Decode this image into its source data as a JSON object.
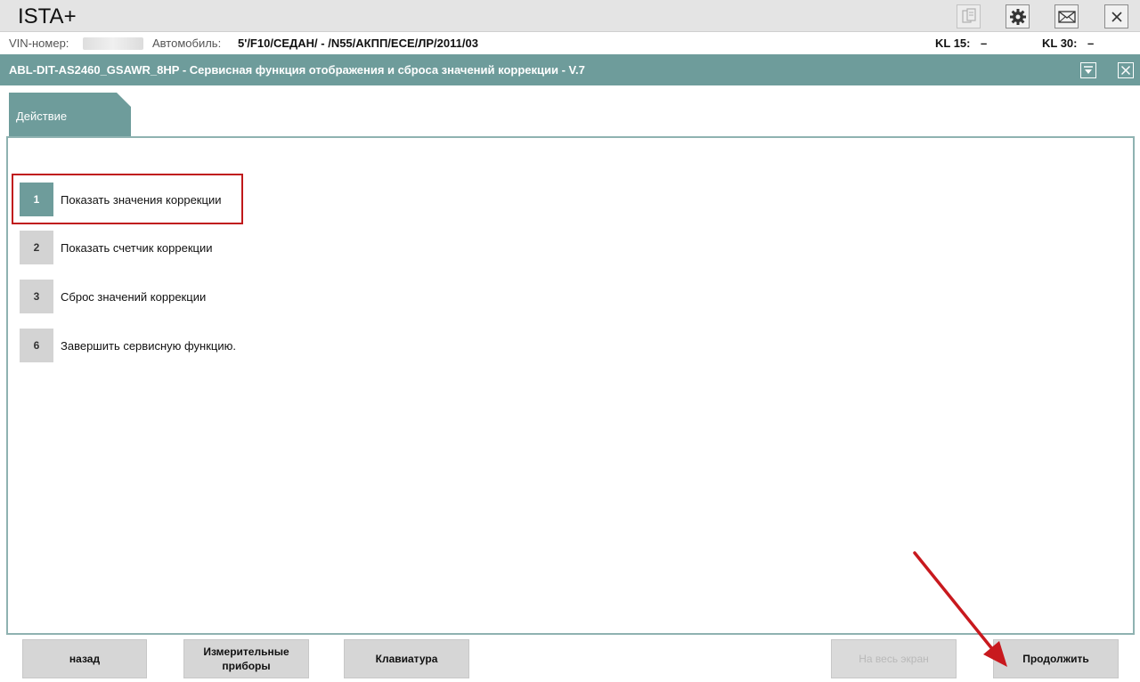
{
  "app": {
    "title": "ISTA+"
  },
  "info": {
    "vin_label": "VIN-номер:",
    "vehicle_label": "Автомобиль:",
    "vehicle_value": "5'/F10/СЕДАН/ - /N55/АКПП/ECE/ЛР/2011/03",
    "kl15_label": "KL 15:",
    "kl15_value": "–",
    "kl30_label": "KL 30:",
    "kl30_value": "–"
  },
  "header": {
    "title": "ABL-DIT-AS2460_GSAWR_8HP - Сервисная функция отображения и сброса значений коррекции - V.7"
  },
  "tab": {
    "label": "Действие"
  },
  "items": [
    {
      "num": "1",
      "label": "Показать значения коррекции",
      "active": true
    },
    {
      "num": "2",
      "label": "Показать счетчик коррекции",
      "active": false
    },
    {
      "num": "3",
      "label": "Сброс значений коррекции",
      "active": false
    },
    {
      "num": "6",
      "label": "Завершить сервисную функцию.",
      "active": false
    }
  ],
  "buttons": {
    "back": "назад",
    "measuring_line1": "Измерительные",
    "measuring_line2": "приборы",
    "keyboard": "Клавиатура",
    "fullscreen": "На весь экран",
    "continue": "Продолжить"
  },
  "colors": {
    "accent": "#6e9c9b",
    "highlight": "#c0191b",
    "arrow": "#c8191e"
  },
  "icons": [
    "document-icon",
    "gear-icon",
    "mail-icon",
    "close-icon",
    "dropdown-icon",
    "close-icon"
  ]
}
